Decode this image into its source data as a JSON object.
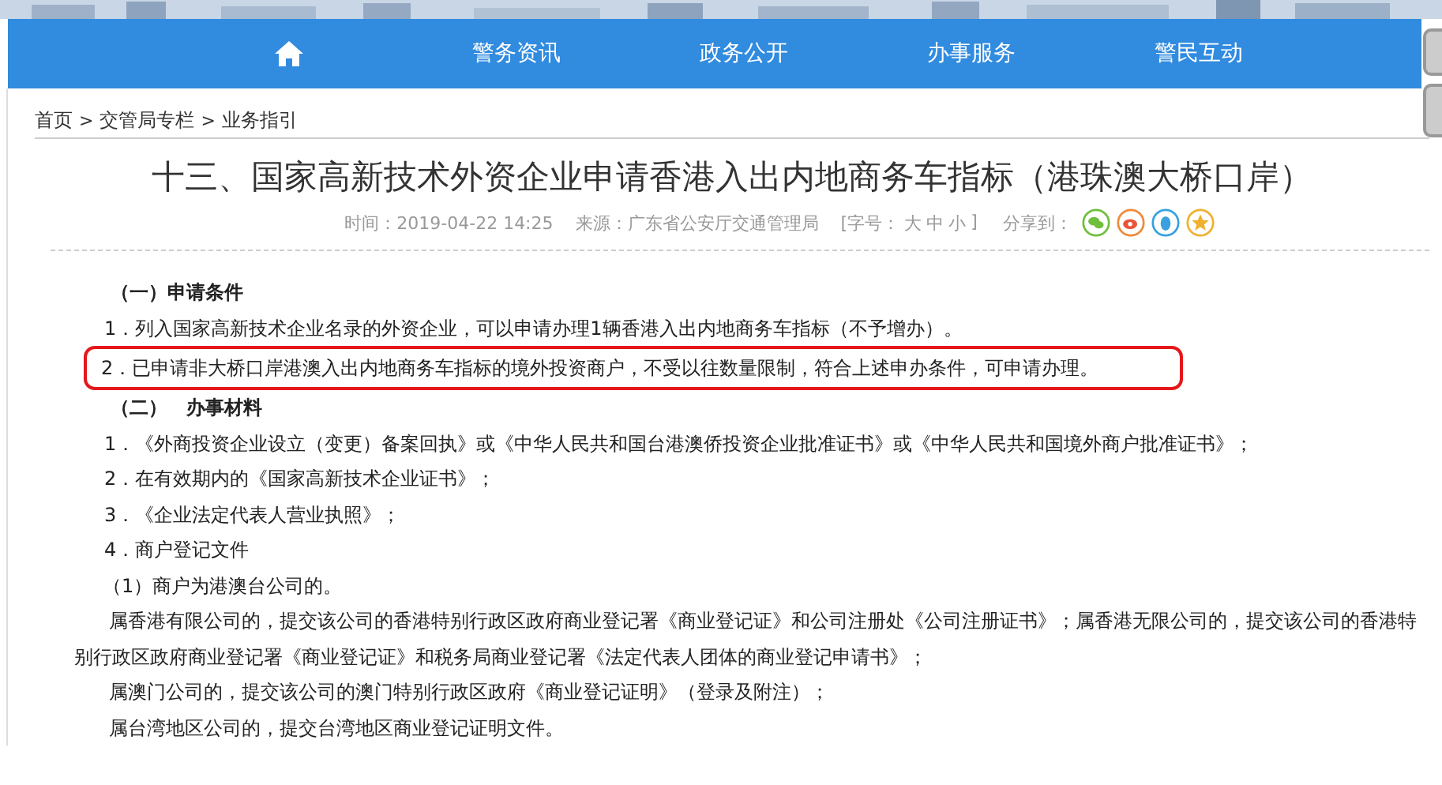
{
  "nav": {
    "items": [
      {
        "label": "警务资讯"
      },
      {
        "label": "政务公开"
      },
      {
        "label": "办事服务"
      },
      {
        "label": "警民互动"
      }
    ]
  },
  "breadcrumb": [
    "首页",
    "交管局专栏",
    "业务指引"
  ],
  "breadcrumb_separator": ">",
  "article": {
    "title": "十三、国家高新技术外资企业申请香港入出内地商务车指标（港珠澳大桥口岸）",
    "time": "时间：2019-04-22 14:25",
    "source": "来源：广东省公安厅交通管理局",
    "font_size": {
      "prefix": "[字号：",
      "options": [
        "大",
        "中",
        "小"
      ],
      "suffix": "]"
    },
    "share_label": "分享到：",
    "paragraphs": [
      {
        "kind": "heading",
        "text": "（一）申请条件",
        "highlighted": false
      },
      {
        "kind": "item",
        "text": "1．列入国家高新技术企业名录的外资企业，可以申请办理1辆香港入出内地商务车指标（不予增办）。",
        "highlighted": false
      },
      {
        "kind": "item",
        "text": "2．已申请非大桥口岸港澳入出内地商务车指标的境外投资商户，不受以往数量限制，符合上述申办条件，可申请办理。",
        "highlighted": true
      },
      {
        "kind": "heading",
        "text": "（二）　办事材料",
        "highlighted": false
      },
      {
        "kind": "item",
        "text": "1．《外商投资企业设立（变更）备案回执》或《中华人民共和国台港澳侨投资企业批准证书》或《中华人民共和国境外商户批准证书》；",
        "highlighted": false
      },
      {
        "kind": "item",
        "text": "2．在有效期内的《国家高新技术企业证书》；",
        "highlighted": false
      },
      {
        "kind": "item",
        "text": "3．《企业法定代表人营业执照》；",
        "highlighted": false
      },
      {
        "kind": "item",
        "text": "4．商户登记文件",
        "highlighted": false
      },
      {
        "kind": "sub",
        "text": "（1）商户为港澳台公司的。",
        "highlighted": false
      },
      {
        "kind": "para",
        "text": "属香港有限公司的，提交该公司的香港特别行政区政府商业登记署《商业登记证》和公司注册处《公司注册证书》；属香港无限公司的，提交该公司的香港特别行政区政府商业登记署《商业登记证》和税务局商业登记署《法定代表人团体的商业登记申请书》；",
        "highlighted": false
      },
      {
        "kind": "para",
        "text": "属澳门公司的，提交该公司的澳门特别行政区政府《商业登记证明》（登录及附注）；",
        "highlighted": false
      },
      {
        "kind": "para",
        "text": "属台湾地区公司的，提交台湾地区商业登记证明文件。",
        "highlighted": false
      }
    ]
  }
}
